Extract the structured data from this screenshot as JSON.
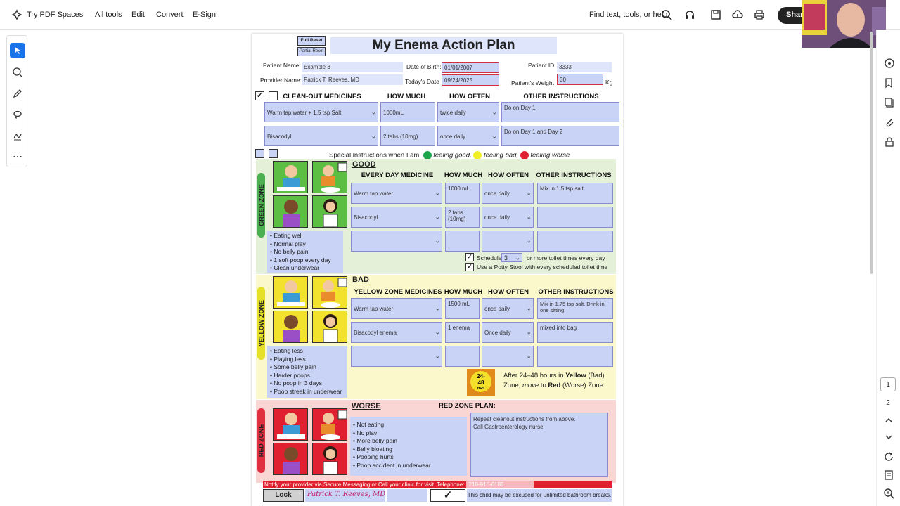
{
  "toolbar": {
    "brand": "Try PDF Spaces",
    "menu": [
      "All tools",
      "Edit",
      "Convert",
      "E-Sign"
    ],
    "find": "Find text, tools, or help",
    "share": "Share"
  },
  "page_nav": {
    "page1": "1",
    "page2": "2"
  },
  "doc": {
    "title": "My Enema Action Plan",
    "full_reset": "Full Reset",
    "partial_reset": "Partial Reset",
    "patient_name_label": "Patient Name:",
    "patient_name": "Example 3",
    "dob_label": "Date of Birth:",
    "dob": "01/01/2007",
    "patient_id_label": "Patient ID:",
    "patient_id": "3333",
    "provider_label": "Provider Name:",
    "provider": "Patrick T. Reeves, MD",
    "today_label": "Today's Date",
    "today": "09/24/2025",
    "weight_label": "Patient's Weight",
    "weight": "30",
    "weight_unit": "Kg",
    "cleanout": {
      "check": "✓",
      "headers": [
        "CLEAN-OUT MEDICINES",
        "HOW MUCH",
        "HOW OFTEN",
        "OTHER INSTRUCTIONS"
      ],
      "rows": [
        {
          "med": "Warm tap water + 1.5 tsp Salt",
          "much": "1000mL",
          "often": "twice daily",
          "other": "Do on Day 1"
        },
        {
          "med": "Bisacodyl",
          "much": "2 tabs (10mg)",
          "often": "once daily",
          "other": "Do on Day 1 and Day 2"
        }
      ]
    },
    "special": {
      "prefix": "Special instructions when I am:",
      "good": "feeling good,",
      "bad": "feeling bad,",
      "worse": "feeling worse"
    },
    "green": {
      "tab": "GREEN ZONE",
      "title": "GOOD",
      "headers": [
        "EVERY DAY MEDICINE",
        "HOW MUCH",
        "HOW OFTEN",
        "OTHER INSTRUCTIONS"
      ],
      "rows": [
        {
          "med": "Warm tap water",
          "much": "1000 mL",
          "often": "once daily",
          "other": "Mix in 1.5 tsp salt"
        },
        {
          "med": "Bisacodyl",
          "much": "2 tabs (10mg)",
          "often": "once daily",
          "other": ""
        },
        {
          "med": "",
          "much": "",
          "often": "",
          "other": ""
        }
      ],
      "bullets": [
        "Eating well",
        "Normal play",
        "No belly pain",
        "1 soft poop every day",
        "Clean underwear"
      ],
      "schedule_prefix": "Schedule",
      "schedule_value": "3",
      "schedule_suffix": "or more toilet times every day",
      "stool_text": "Use a Potty Stool with every scheduled toilet time"
    },
    "yellow": {
      "tab": "YELLOW ZONE",
      "title": "BAD",
      "headers": [
        "YELLOW ZONE MEDICINES",
        "HOW MUCH",
        "HOW OFTEN",
        "OTHER INSTRUCTIONS"
      ],
      "rows": [
        {
          "med": "Warm tap water",
          "much": "1500 mL",
          "often": "once daily",
          "other": "Mix in 1.75 tsp salt. Drink in one sitting"
        },
        {
          "med": "Bisacodyl enema",
          "much": "1 enema",
          "often": "Once daily",
          "other": "mixed into bag"
        },
        {
          "med": "",
          "much": "",
          "often": "",
          "other": ""
        }
      ],
      "bullets": [
        "Eating less",
        "Playing less",
        "Some belly pain",
        "Harder poops",
        "No poop in 3 days",
        "Poop streak in underwear"
      ],
      "badge_top": "24-",
      "badge_mid": "48",
      "badge_bot": "HRS",
      "after_1": "After 24–48 hours in",
      "after_yellow": "Yellow",
      "after_2": "(Bad)",
      "after_3": "Zone,",
      "after_move": "move",
      "after_4": "to",
      "after_red": "Red",
      "after_5": "(Worse) Zone."
    },
    "red": {
      "tab": "RED ZONE",
      "title": "WORSE",
      "plan_label": "RED ZONE PLAN:",
      "bullets": [
        "Not eating",
        "No play",
        "More belly pain",
        "Belly bloating",
        "Pooping hurts",
        "Poop accident in underwear"
      ],
      "plan_line1": "Repeat cleanout instructions from above.",
      "plan_line2": "Call Gastroenterology nurse"
    },
    "footer": {
      "notify": "Notify your provider via Secure Messaging or Call your clinic for visit. Telephone:",
      "phone": "210-916-6185",
      "lock": "Lock",
      "signature": "Patrick T. Reeves, MD",
      "check": "✓",
      "excuse": "This child may be excused for unlimited bathroom breaks."
    }
  },
  "colors": {
    "field": "#c9d3f5",
    "green_bg": "#e4f1d8",
    "yellow_bg": "#fbf8cc",
    "red_bg": "#f9d6d4",
    "green_tab": "#4caf50",
    "yellow_tab": "#e6e02a",
    "red_tab": "#e03040"
  }
}
